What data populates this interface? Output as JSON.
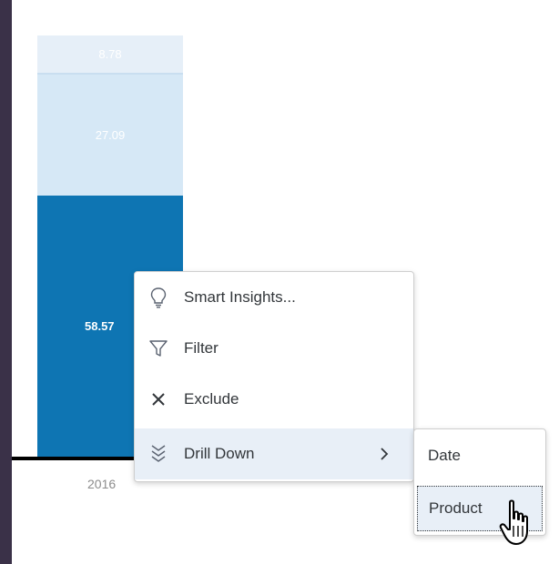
{
  "chart_data": {
    "type": "bar",
    "categories": [
      "2016"
    ],
    "series": [
      {
        "values": [
          58.57
        ]
      },
      {
        "values": [
          27.09
        ]
      },
      {
        "values": [
          8.78
        ]
      }
    ],
    "labels": {
      "low": "58.57",
      "mid": "27.09",
      "top": "8.78"
    }
  },
  "context_menu": {
    "items": [
      {
        "label": "Smart Insights...",
        "icon": "lightbulb-icon"
      },
      {
        "label": "Filter",
        "icon": "filter-icon"
      },
      {
        "label": "Exclude",
        "icon": "close-icon"
      },
      {
        "label": "Drill Down",
        "icon": "drill-down-icon",
        "has_submenu": true
      }
    ]
  },
  "submenu": {
    "items": [
      {
        "label": "Date"
      },
      {
        "label": "Product"
      }
    ]
  },
  "colors": {
    "bar_dark": "#0e75b3",
    "bar_mid": "#d6e8f6",
    "bar_light": "#e6eff8",
    "menu_highlight": "#e8eff7",
    "sidebar": "#3a3148"
  }
}
